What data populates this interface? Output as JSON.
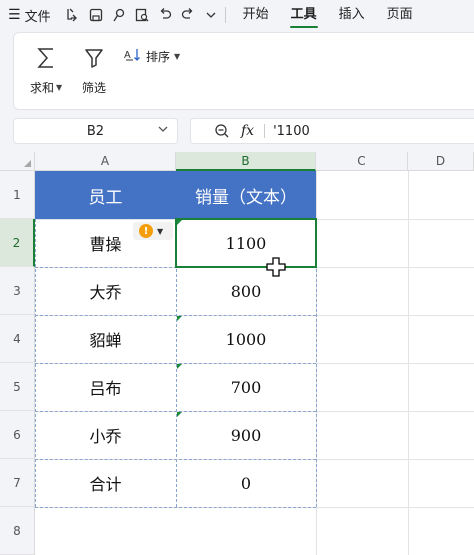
{
  "menubar": {
    "file_label": "文件",
    "tabs": [
      {
        "label": "开始",
        "active": false
      },
      {
        "label": "工具",
        "active": true
      },
      {
        "label": "插入",
        "active": false
      },
      {
        "label": "页面",
        "active": false
      }
    ]
  },
  "ribbon": {
    "sum_label": "求和",
    "filter_label": "筛选",
    "sort_label": "排序"
  },
  "formula_bar": {
    "name_box": "B2",
    "content": "'1100"
  },
  "columns": [
    "A",
    "B",
    "C",
    "D"
  ],
  "rows": [
    "1",
    "2",
    "3",
    "4",
    "5",
    "6",
    "7",
    "8"
  ],
  "table": {
    "headers": [
      "员工",
      "销量（文本）"
    ],
    "rows": [
      [
        "曹操",
        "1100"
      ],
      [
        "大乔",
        "800"
      ],
      [
        "貂蝉",
        "1000"
      ],
      [
        "吕布",
        "700"
      ],
      [
        "小乔",
        "900"
      ],
      [
        "合计",
        "0"
      ]
    ]
  },
  "selected_cell": "B2",
  "warning_icon": "!",
  "colors": {
    "header_fill": "#4472c4",
    "accent_green": "#1a7f37",
    "warning": "#f59e0b"
  }
}
